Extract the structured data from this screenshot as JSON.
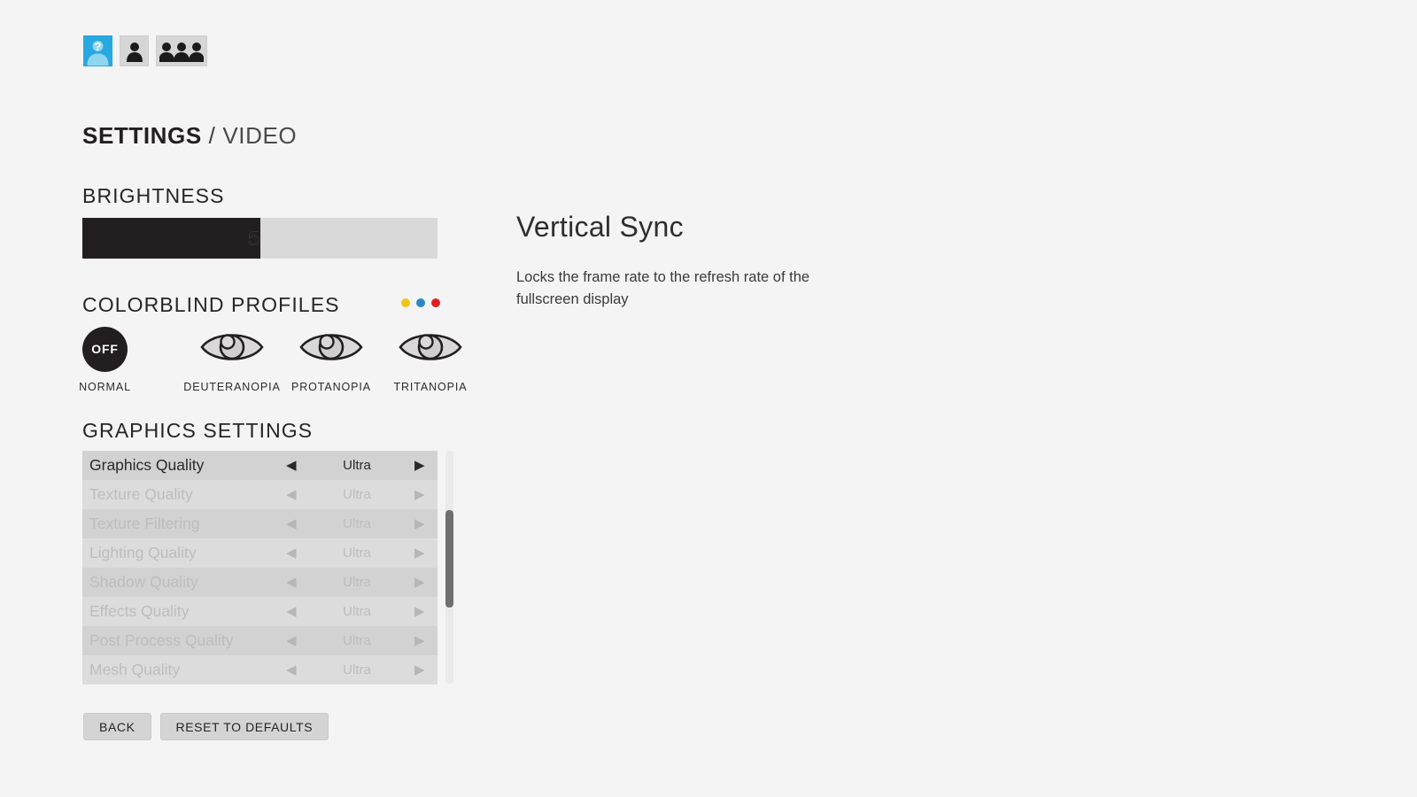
{
  "profile_bar": {
    "tiles": [
      {
        "name": "player-help-profile",
        "icon": "person-question-icon",
        "active": true
      },
      {
        "name": "single-player",
        "icon": "person-icon",
        "active": false
      },
      {
        "name": "multiplayer",
        "icon": "people-group-icon",
        "active": false
      }
    ]
  },
  "header": {
    "title_main": "SETTINGS",
    "separator": " / ",
    "title_sub": "VIDEO"
  },
  "brightness": {
    "heading": "BRIGHTNESS",
    "value": "50",
    "fill_percent": 50
  },
  "colorblind": {
    "heading": "COLORBLIND PROFILES",
    "dots": [
      {
        "name": "dot-yellow",
        "color": "#f0c419"
      },
      {
        "name": "dot-blue",
        "color": "#2b87c8"
      },
      {
        "name": "dot-red",
        "color": "#e02020"
      }
    ],
    "profiles": [
      {
        "label": "NORMAL",
        "badge": "OFF",
        "icon": "off-circle-icon",
        "selected": true
      },
      {
        "label": "DEUTERANOPIA",
        "icon": "eye-icon",
        "selected": false
      },
      {
        "label": "PROTANOPIA",
        "icon": "eye-icon",
        "selected": false
      },
      {
        "label": "TRITANOPIA",
        "icon": "eye-icon",
        "selected": false
      }
    ]
  },
  "graphics": {
    "heading": "GRAPHICS SETTINGS",
    "left_arrow": "◀",
    "right_arrow": "▶",
    "rows": [
      {
        "label": "Graphics Quality",
        "value": "Ultra",
        "enabled": true
      },
      {
        "label": "Texture Quality",
        "value": "Ultra",
        "enabled": false
      },
      {
        "label": "Texture Filtering",
        "value": "Ultra",
        "enabled": false
      },
      {
        "label": "Lighting Quality",
        "value": "Ultra",
        "enabled": false
      },
      {
        "label": "Shadow Quality",
        "value": "Ultra",
        "enabled": false
      },
      {
        "label": "Effects Quality",
        "value": "Ultra",
        "enabled": false
      },
      {
        "label": "Post Process Quality",
        "value": "Ultra",
        "enabled": false
      },
      {
        "label": "Mesh Quality",
        "value": "Ultra",
        "enabled": false
      }
    ],
    "scroll_thumb_percent": 44
  },
  "buttons": [
    {
      "name": "back-button",
      "label": "BACK"
    },
    {
      "name": "reset-defaults-button",
      "label": "RESET TO DEFAULTS"
    }
  ],
  "detail": {
    "title": "Vertical Sync",
    "description": "Locks the frame rate to the refresh rate of the fullscreen display"
  },
  "colors": {
    "background": "#f4f4f4",
    "accent_blue": "#28a8e0",
    "slider_fill": "#231f20",
    "slider_track": "#d9d9d9"
  }
}
